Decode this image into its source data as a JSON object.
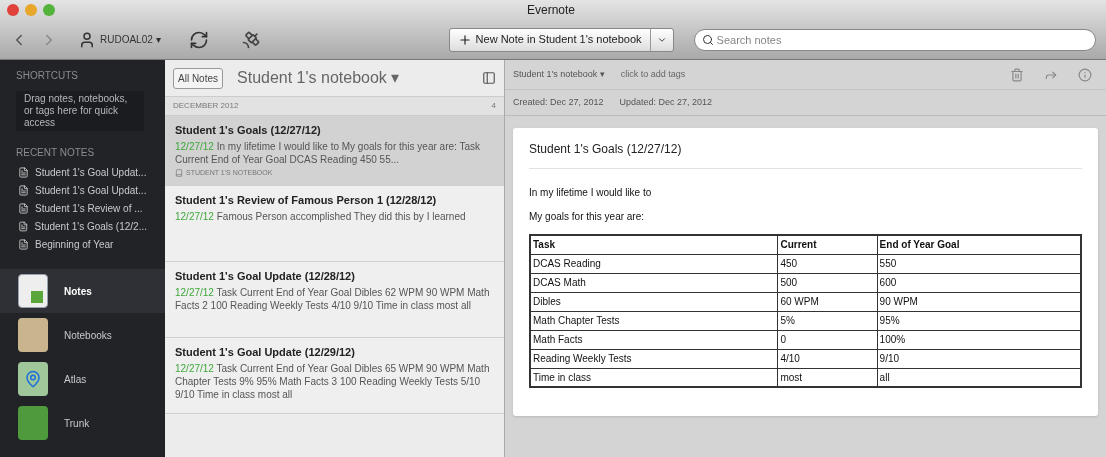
{
  "window": {
    "title": "Evernote"
  },
  "toolbar": {
    "account": "RUDOAL02 ▾",
    "new_note": "New Note in Student 1's notebook",
    "search": {
      "placeholder": "Search notes"
    }
  },
  "sidebar": {
    "shortcuts_heading": "SHORTCUTS",
    "shortcuts_hint": "Drag notes, notebooks, or tags here for quick access",
    "recent_heading": "RECENT NOTES",
    "recent": [
      "Student 1's Goal Updat...",
      "Student 1's Goal Updat...",
      "Student 1's Review of ...",
      "Student 1's Goals (12/2...",
      "Beginning of Year"
    ],
    "nav": [
      {
        "label": "Notes",
        "kind": "notes",
        "selected": true
      },
      {
        "label": "Notebooks",
        "kind": "notebooks",
        "selected": false
      },
      {
        "label": "Atlas",
        "kind": "atlas",
        "selected": false
      },
      {
        "label": "Trunk",
        "kind": "trunk",
        "selected": false
      }
    ]
  },
  "note_list": {
    "all_notes": "All Notes",
    "notebook": "Student 1's notebook ▾",
    "group": "DECEMBER 2012",
    "count": "4",
    "notes": [
      {
        "title": "Student 1's Goals (12/27/12)",
        "date": "12/27/12",
        "snippet": "In my lifetime I would like to My goals for this year are: Task Current End of Year Goal DCAS Reading 450 55...",
        "notebook": "STUDENT 1'S NOTEBOOK",
        "selected": true
      },
      {
        "title": "Student 1's Review of Famous Person 1 (12/28/12)",
        "date": "12/27/12",
        "snippet": "Famous Person accomplished They did this by I learned",
        "selected": false
      },
      {
        "title": "Student 1's Goal Update (12/28/12)",
        "date": "12/27/12",
        "snippet": "Task Current End of Year Goal Dibles 62 WPM 90 WPM Math Facts 2 100 Reading Weekly Tests 4/10 9/10 Time in class most all",
        "selected": false
      },
      {
        "title": "Student 1's Goal Update (12/29/12)",
        "date": "12/27/12",
        "snippet": "Task Current End of Year Goal Dibles 65 WPM 90 WPM Math Chapter Tests 9% 95% Math Facts 3 100 Reading Weekly Tests 5/10 9/10 Time in class most all",
        "selected": false
      }
    ]
  },
  "note": {
    "notebook": "Student 1's notebook ▾",
    "tags_placeholder": "click to add tags",
    "created": "Created: Dec 27, 2012",
    "updated": "Updated: Dec 27, 2012",
    "title": "Student 1's Goals (12/27/12)",
    "paragraphs": [
      "In my lifetime I would like to",
      "My goals for this year are:"
    ],
    "table": {
      "columns": [
        "Task",
        "Current",
        "End of Year Goal"
      ],
      "rows": [
        [
          "DCAS Reading",
          "450",
          "550"
        ],
        [
          "DCAS Math",
          "500",
          "600"
        ],
        [
          "Dibles",
          "60 WPM",
          "90 WPM"
        ],
        [
          "Math Chapter Tests",
          "5%",
          "95%"
        ],
        [
          "Math Facts",
          "0",
          "100%"
        ],
        [
          "Reading Weekly Tests",
          "4/10",
          "9/10"
        ],
        [
          "Time in class",
          "most",
          "all"
        ]
      ]
    }
  }
}
